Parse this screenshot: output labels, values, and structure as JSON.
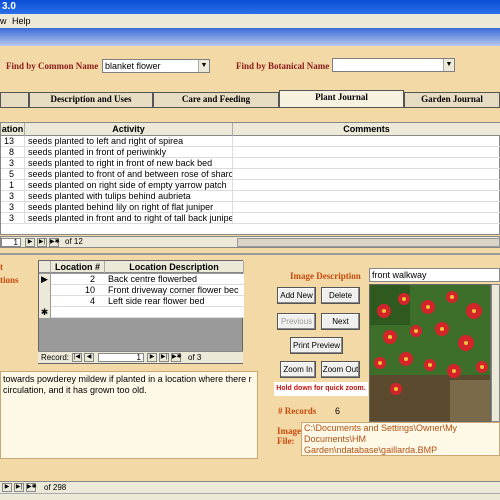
{
  "window": {
    "title": "3.0"
  },
  "menu": {
    "view": "w",
    "help": "Help"
  },
  "find": {
    "common_label": "Find by Common Name",
    "common_value": "blanket flower",
    "botanical_label": "Find by Botanical Name",
    "botanical_value": ""
  },
  "tabs": [
    {
      "label": "Description and Uses"
    },
    {
      "label": "Care and Feeding"
    },
    {
      "label": "Plant Journal"
    },
    {
      "label": "Garden Journal"
    }
  ],
  "journal": {
    "columns": [
      "ation",
      "Activity",
      "Comments"
    ],
    "rows": [
      {
        "loc": "13",
        "activity": "seeds planted to left and right of spirea",
        "comments": ""
      },
      {
        "loc": "8",
        "activity": "seeds planted in front of periwinkly",
        "comments": ""
      },
      {
        "loc": "3",
        "activity": "seeds planted to right in front of new back bed",
        "comments": ""
      },
      {
        "loc": "5",
        "activity": "seeds planted to front of and between rose of sharon",
        "comments": ""
      },
      {
        "loc": "1",
        "activity": "seeds planted on right side of empty yarrow patch",
        "comments": ""
      },
      {
        "loc": "3",
        "activity": "seeds planted with tulips behind aubrieta",
        "comments": ""
      },
      {
        "loc": "3",
        "activity": "seeds planted behind lily on right of flat juniper",
        "comments": ""
      },
      {
        "loc": "3",
        "activity": "seeds planted in front and to right of tall back juniper",
        "comments": ""
      }
    ],
    "nav_current": "1",
    "nav_of": "of  12"
  },
  "locations_label_1": "t",
  "locations_label_2": "tions",
  "locations": {
    "columns": [
      "Location #",
      "Location Description"
    ],
    "rows": [
      {
        "num": "2",
        "desc": "Back centre flowerbed",
        "selector": "▶"
      },
      {
        "num": "10",
        "desc": "Front driveway corner flower bec",
        "selector": ""
      },
      {
        "num": "4",
        "desc": "Left side rear flower bed",
        "selector": ""
      },
      {
        "num": "",
        "desc": "",
        "selector": "✱"
      }
    ],
    "record_label": "Record:",
    "nav_current": "1",
    "nav_of": "of  3"
  },
  "notes_text": "towards powderey mildew if planted in a location where there r circulation, and it has grown too old.",
  "image": {
    "desc_label": "Image Description",
    "desc_value": "front walkway",
    "add_new": "Add New",
    "delete": "Delete",
    "previous": "Previous",
    "next": "Next",
    "print_preview": "Print Preview",
    "zoom_in": "Zoom In",
    "zoom_out": "Zoom Out",
    "hold_hint": "Hold down for quick zoom.",
    "records_label": "# Records",
    "records_value": "6",
    "file_label_1": "Image",
    "file_label_2": "File:",
    "file_path": "C:\\Documents and Settings\\Owner\\My Documents\\HM Garden\\ndatabase\\gaillarda.BMP"
  },
  "bottom_nav": {
    "of": "of  298"
  }
}
